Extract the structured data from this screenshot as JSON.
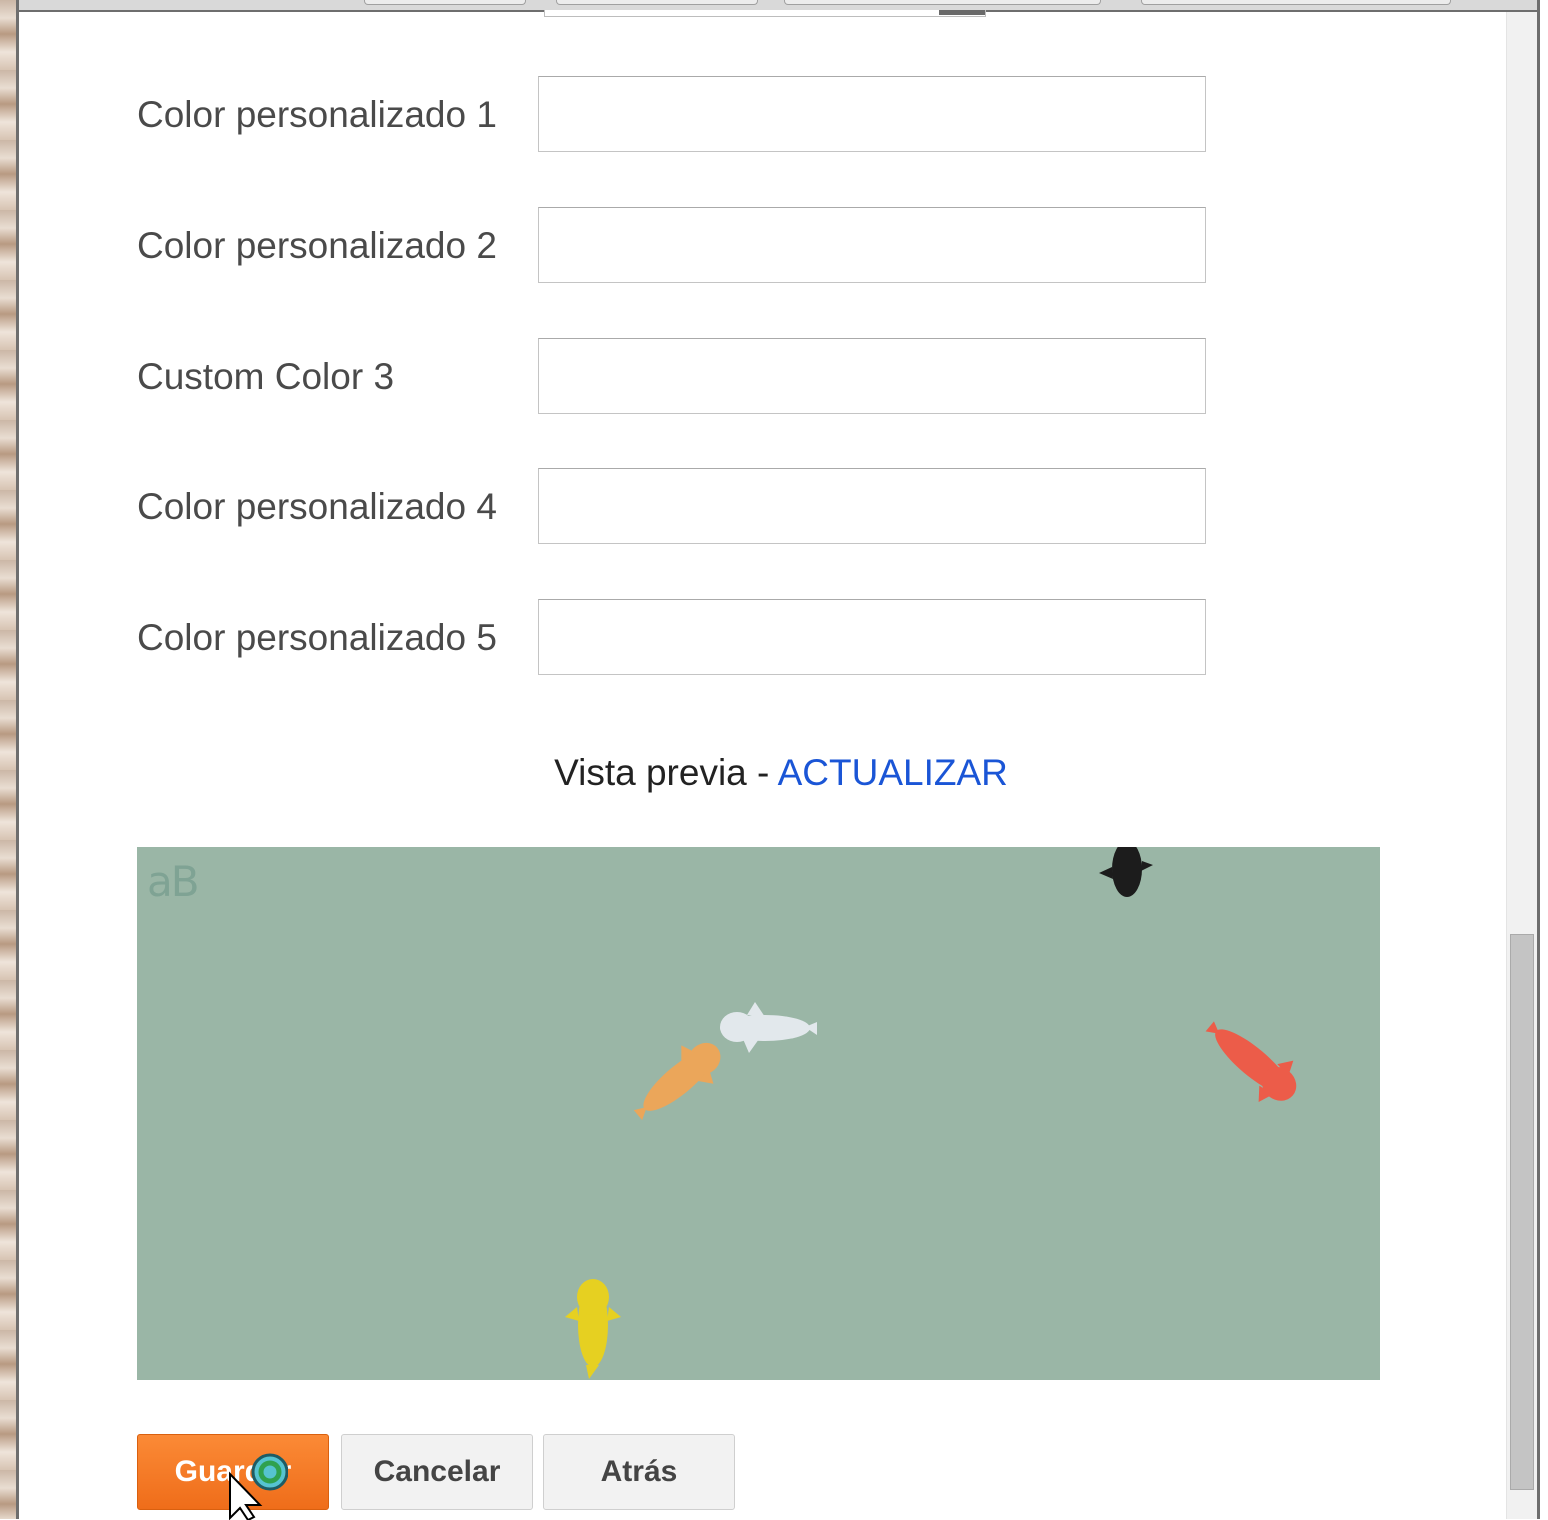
{
  "form": {
    "fields": [
      {
        "label": "Color personalizado 1",
        "value": ""
      },
      {
        "label": "Color personalizado 2",
        "value": ""
      },
      {
        "label": "Custom Color 3",
        "value": ""
      },
      {
        "label": "Color personalizado 4",
        "value": ""
      },
      {
        "label": "Color personalizado 5",
        "value": ""
      }
    ]
  },
  "preview": {
    "label": "Vista previa",
    "separator": " - ",
    "refresh_link": "ACTUALIZAR",
    "logo_text": "aB",
    "background_color": "#9ab6a6",
    "fish_colors": [
      "#1c1c1c",
      "#dfe6ea",
      "#eba65a",
      "#ec5c49",
      "#e6d021"
    ]
  },
  "buttons": {
    "save": "Guardar",
    "cancel": "Cancelar",
    "back": "Atrás"
  },
  "colors": {
    "accent_button": "#f47a25",
    "link": "#1a55d6"
  }
}
